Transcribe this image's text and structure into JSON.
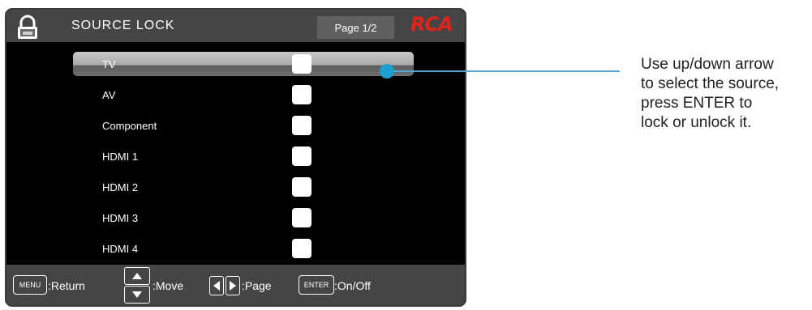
{
  "header": {
    "title": "SOURCE LOCK",
    "page_indicator": "Page 1/2",
    "brand": "RCA",
    "icon": "lock-icon"
  },
  "sources": [
    {
      "label": "TV",
      "selected": true,
      "locked": false
    },
    {
      "label": "AV",
      "selected": false,
      "locked": false
    },
    {
      "label": "Component",
      "selected": false,
      "locked": false
    },
    {
      "label": "HDMI 1",
      "selected": false,
      "locked": false
    },
    {
      "label": "HDMI 2",
      "selected": false,
      "locked": false
    },
    {
      "label": "HDMI 3",
      "selected": false,
      "locked": false
    },
    {
      "label": "HDMI 4",
      "selected": false,
      "locked": false
    }
  ],
  "footer": {
    "menu_key": "MENU",
    "return_label": ":Return",
    "move_label": ":Move",
    "page_label": ":Page",
    "enter_key": "ENTER",
    "onoff_label": ":On/Off"
  },
  "callout": {
    "lines": [
      "Use up/down arrow",
      "to select the source,",
      "press ENTER to",
      "lock or unlock it."
    ]
  },
  "colors": {
    "brand": "#e2231a",
    "callout_accent": "#1c9ed0",
    "panel_bg": "#000000",
    "bar_bg": "#454545"
  }
}
